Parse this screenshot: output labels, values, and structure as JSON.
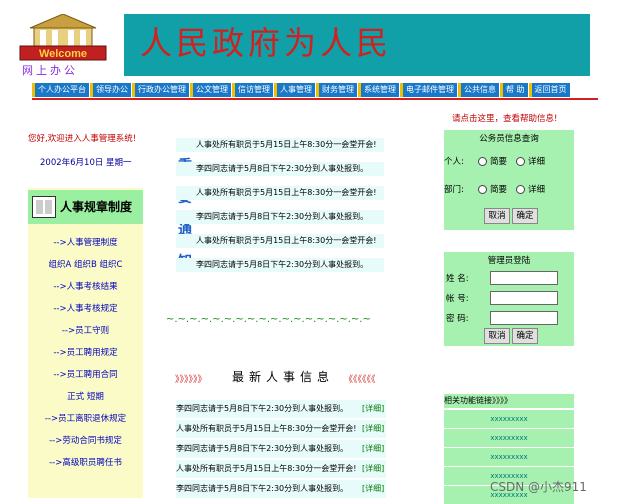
{
  "header": {
    "logo_text": "Welcome",
    "logo_sub": "网上办公",
    "banner_title": "人民政府为人民"
  },
  "nav": [
    "个人办公平台",
    "领导办公",
    "行政办公管理",
    "公文管理",
    "信访管理",
    "人事管理",
    "财务管理",
    "系统管理",
    "电子邮件管理",
    "公共信息",
    "帮 助",
    "返回首页"
  ],
  "left": {
    "welcome": "您好,欢迎进入人事管理系统!",
    "date": "2002年6月10日 星期一",
    "rules_title": "人事规章制度",
    "rules": [
      "-->人事管理制度",
      "组织A 组织B 组织C",
      "-->人事考核结果",
      "-->人事考核规定",
      "-->员工守则",
      "-->员工聘用规定",
      "-->员工聘用合同",
      "正式 短期",
      "-->员工离职退休规定",
      "-->劳动合同书规定",
      "-->高级职员聘任书"
    ]
  },
  "middle": {
    "important_label": [
      "重",
      "要",
      "通",
      "知"
    ],
    "notices": [
      "人事处所有职员于5月15日上午8:30分一会堂开会!",
      "李四同志请于5月8日下午2:30分到人事处报到。",
      "人事处所有职员于5月15日上午8:30分一会堂开会!",
      "李四同志请于5月8日下午2:30分到人事处报到。",
      "人事处所有职员于5月15日上午8:30分一会堂开会!",
      "李四同志请于5月8日下午2:30分到人事处报到。"
    ],
    "wavy": "~.~.~.~.~.~.~.~.~.~.~.~.~.~.~.~.~.~",
    "latest_left": "》》》》》》",
    "latest_title": "最新人事信息",
    "latest_right": "《《《《《《",
    "latest": [
      {
        "text": "李四同志请于5月8日下午2:30分到人事处报到。",
        "detail": "[详细]"
      },
      {
        "text": "人事处所有职员于5月15日上午8:30分一会堂开会!",
        "detail": "[详细]"
      },
      {
        "text": "李四同志请于5月8日下午2:30分到人事处报到。",
        "detail": "[详细]"
      },
      {
        "text": "人事处所有职员于5月15日上午8:30分一会堂开会!",
        "detail": "[详细]"
      },
      {
        "text": "李四同志请于5月8日下午2:30分到人事处报到。",
        "detail": "[详细]"
      }
    ]
  },
  "right": {
    "help": "请点击这里，查看帮助信息!",
    "query_title": "公务员信息查询",
    "personal_label": "个人:",
    "dept_label": "部门:",
    "simple": "简要",
    "detail": "详细",
    "cancel": "取消",
    "ok": "确定",
    "login_title": "管理员登陆",
    "name_label": "姓 名:",
    "account_label": "帐 号:",
    "password_label": "密 码:",
    "links_title": "相关功能链接》》》》",
    "links": [
      "xxxxxxxxx",
      "xxxxxxxxx",
      "xxxxxxxxx",
      "xxxxxxxxx",
      "xxxxxxxxx"
    ]
  },
  "watermark": "CSDN @小杰911",
  "colors": {
    "banner": "#12a0a8",
    "nav": "#1a78c8",
    "accent": "#d02020",
    "panel_green": "#a6f0b0"
  }
}
